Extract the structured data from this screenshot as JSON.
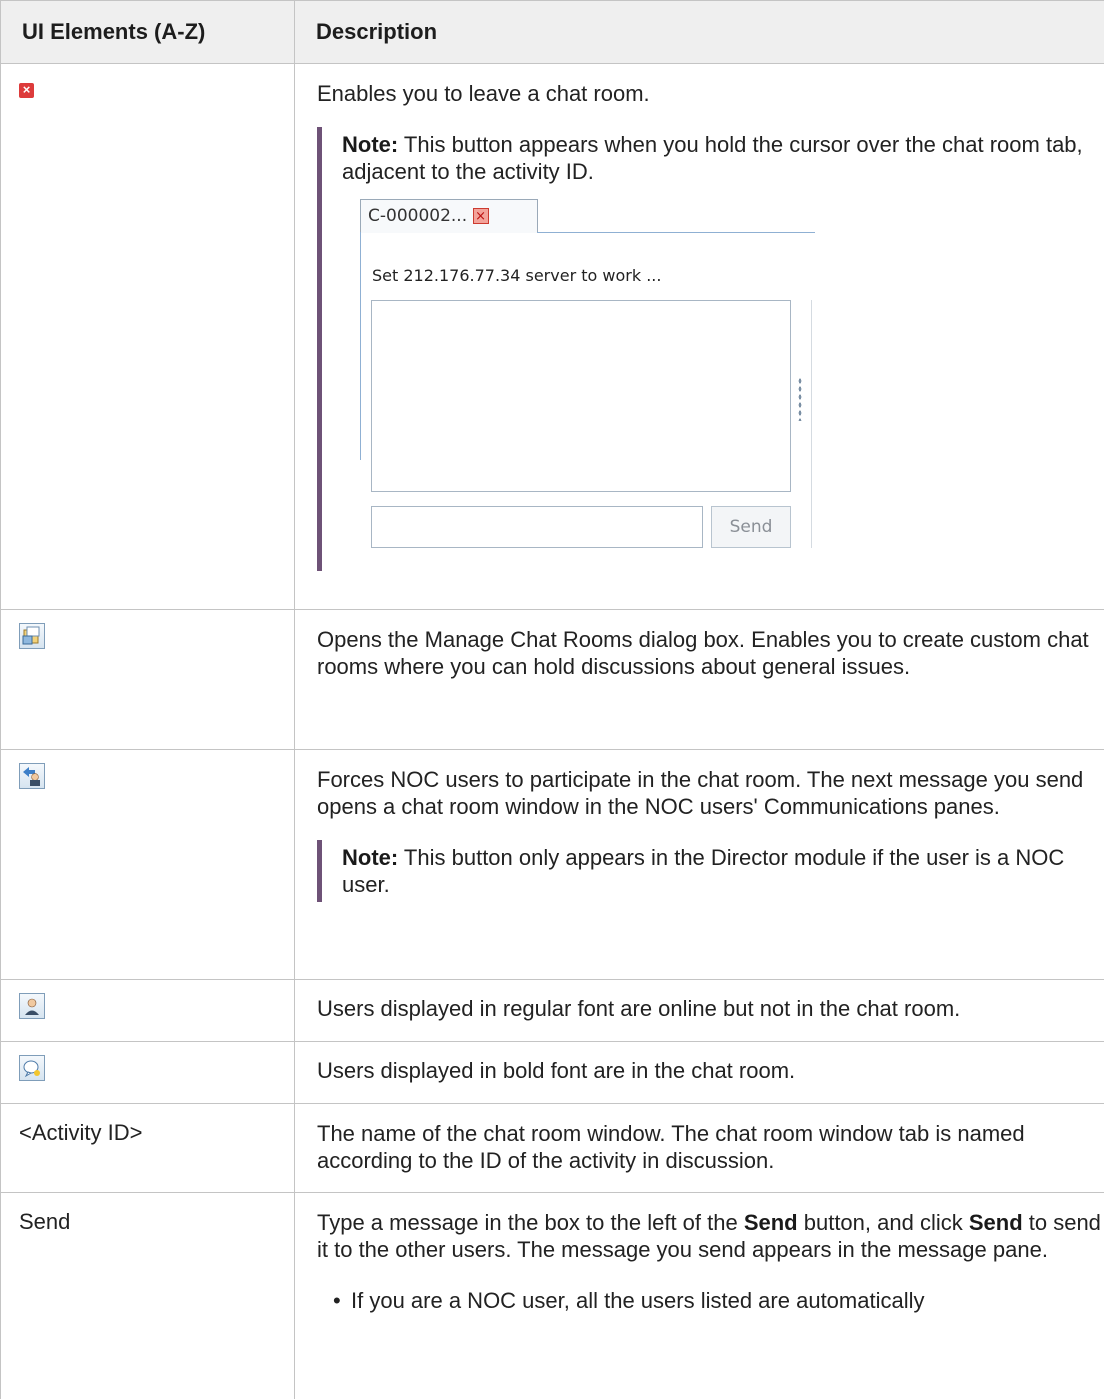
{
  "headers": {
    "col1": "UI Elements (A-Z)",
    "col2": "Description"
  },
  "rows": [
    {
      "element_icon": "leave-chat-icon",
      "description": "Enables you to leave a chat room.",
      "note_label": "Note:",
      "note_text": " This button appears when you hold the cursor over the chat room tab, adjacent to the activity ID.",
      "screenshot": {
        "tab_label": "C-000002...",
        "topic": "Set 212.176.77.34 server to work ...",
        "send_label": "Send"
      }
    },
    {
      "element_icon": "manage-chat-rooms-icon",
      "description": "Opens the Manage Chat Rooms dialog box. Enables you to create custom chat rooms where you can hold discussions about general issues."
    },
    {
      "element_icon": "force-participation-icon",
      "description": "Forces NOC users to participate in the chat room. The next message you send opens a chat room window in the NOC users' Communications panes.",
      "note_label": "Note:",
      "note_text": " This button only appears in the Director module if the user is a NOC user."
    },
    {
      "element_icon": "user-online-icon",
      "description": "Users displayed in regular font are online but not in the chat room."
    },
    {
      "element_icon": "user-in-chat-icon",
      "description": "Users displayed in bold font are in the chat room."
    },
    {
      "element_label": "<Activity ID>",
      "description": "The name of the chat room window. The chat room window tab is named according to the ID of the activity in discussion."
    },
    {
      "element_label": "Send",
      "description_parts": [
        "Type a message in the box to the left of the ",
        "Send",
        " button, and click ",
        "Send",
        " to send it to the other users. The message you send appears in the message pane."
      ],
      "bullet": "If you are a NOC user, all the users listed are automatically"
    }
  ]
}
